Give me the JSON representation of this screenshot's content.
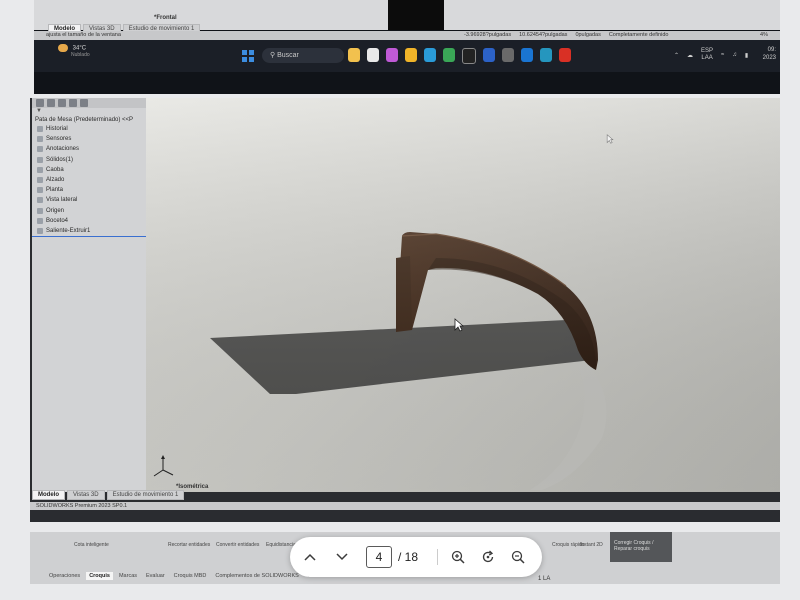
{
  "top_screen": {
    "doc_view": "*Frontal",
    "tabs": [
      "Modelo",
      "Vistas 3D",
      "Estudio de movimiento 1"
    ],
    "status_hint": "ajusta el tamaño de la ventana",
    "coords": [
      "-3.96928?pulgadas",
      "10.62454?pulgadas",
      "0pulgadas"
    ],
    "constraint": "Completamente definido",
    "percent": "4%",
    "weather_temp": "34°C",
    "weather_desc": "Nublado",
    "search_placeholder": "Buscar",
    "lang_top": "ESP",
    "lang_bottom": "LAA",
    "clock_top": "09:",
    "clock_bottom": "2023"
  },
  "feature_manager": {
    "root": "Pata de Mesa (Predeterminado) <<P",
    "items": [
      {
        "label": "Historial",
        "icon": "history-icon"
      },
      {
        "label": "Sensores",
        "icon": "sensor-icon"
      },
      {
        "label": "Anotaciones",
        "icon": "annotation-icon"
      },
      {
        "label": "Sólidos(1)",
        "icon": "solid-bodies-icon"
      },
      {
        "label": "Caoba",
        "icon": "material-icon"
      },
      {
        "label": "Alzado",
        "icon": "plane-icon"
      },
      {
        "label": "Planta",
        "icon": "plane-icon"
      },
      {
        "label": "Vista lateral",
        "icon": "plane-icon"
      },
      {
        "label": "Origen",
        "icon": "origin-icon"
      },
      {
        "label": "Boceto4",
        "icon": "sketch-icon"
      },
      {
        "label": "Saliente-Extruir1",
        "icon": "extrude-icon"
      }
    ]
  },
  "viewport": {
    "view_label": "*Isométrica",
    "tabs": [
      "Modelo",
      "Vistas 3D",
      "Estudio de movimiento 1"
    ],
    "status": "SOLIDWORKS Premium 2023 SP0.1"
  },
  "bottom_screen": {
    "ribbon_buttons": [
      "Cota inteligente",
      "Recortar entidades",
      "Convertir entidades",
      "Equidistanciar",
      "Croquis rápido",
      "Instant 2D",
      "Sombrear croquis"
    ],
    "dark_button": "Corregir Croquis / Reparar croquis",
    "tabs": [
      "Operaciones",
      "Croquis",
      "Marcas",
      "Evaluar",
      "Croquis MBD",
      "Complementos de SOLIDWORKS",
      "Render"
    ],
    "active_tab": "Croquis",
    "fragment": "1 LA"
  },
  "pdf_toolbar": {
    "current_page": "4",
    "total_label": "/ 18",
    "icons": [
      "chevron-up-icon",
      "chevron-down-icon",
      "zoom-in-icon",
      "rotate-icon",
      "zoom-out-icon"
    ]
  },
  "colors": {
    "wood": "#3c2414",
    "taskbar": "#1b1f27",
    "selection": "#3a6fd0",
    "viewport_bg": "#dededa"
  }
}
